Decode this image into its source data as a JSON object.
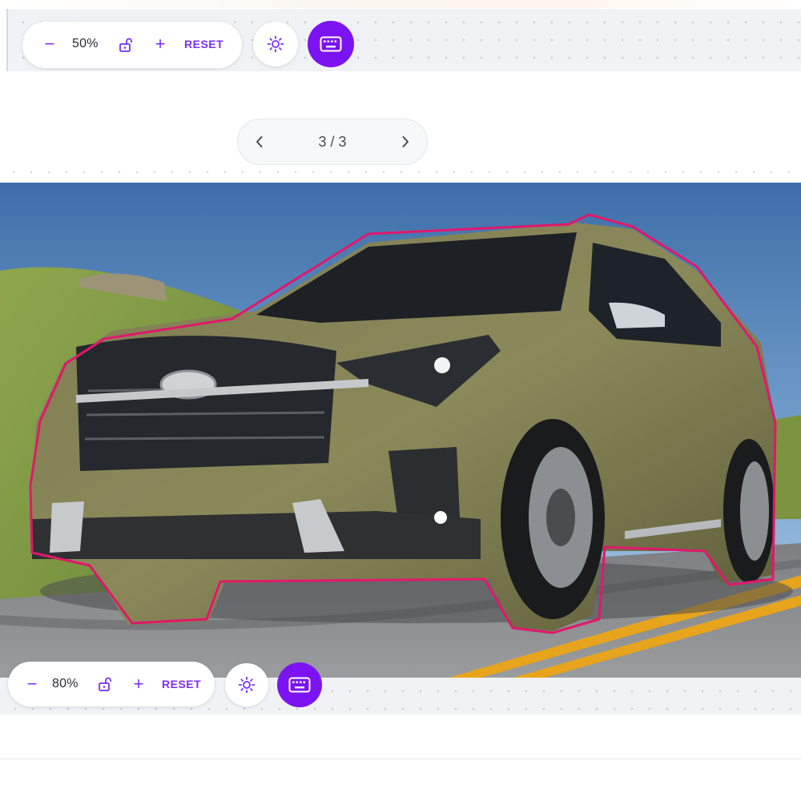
{
  "top_toolbar": {
    "zoom_minus": "−",
    "zoom_value": "50%",
    "zoom_plus": "+",
    "reset_label": "RESET",
    "lock_icon": "lock-open-icon",
    "brightness_icon": "sun-icon",
    "keyboard_icon": "keyboard-icon"
  },
  "pager": {
    "prev_icon": "chevron-left-icon",
    "page_label": "3 / 3",
    "next_icon": "chevron-right-icon"
  },
  "image": {
    "subject": "olive green SUV",
    "outline_color": "#e0186c"
  },
  "bottom_toolbar": {
    "zoom_minus": "−",
    "zoom_value": "80%",
    "zoom_plus": "+",
    "reset_label": "RESET",
    "lock_icon": "lock-open-icon",
    "brightness_icon": "sun-icon",
    "keyboard_icon": "keyboard-icon"
  },
  "colors": {
    "accent": "#7b2ff7",
    "keyboard_button": "#7b14f0"
  }
}
